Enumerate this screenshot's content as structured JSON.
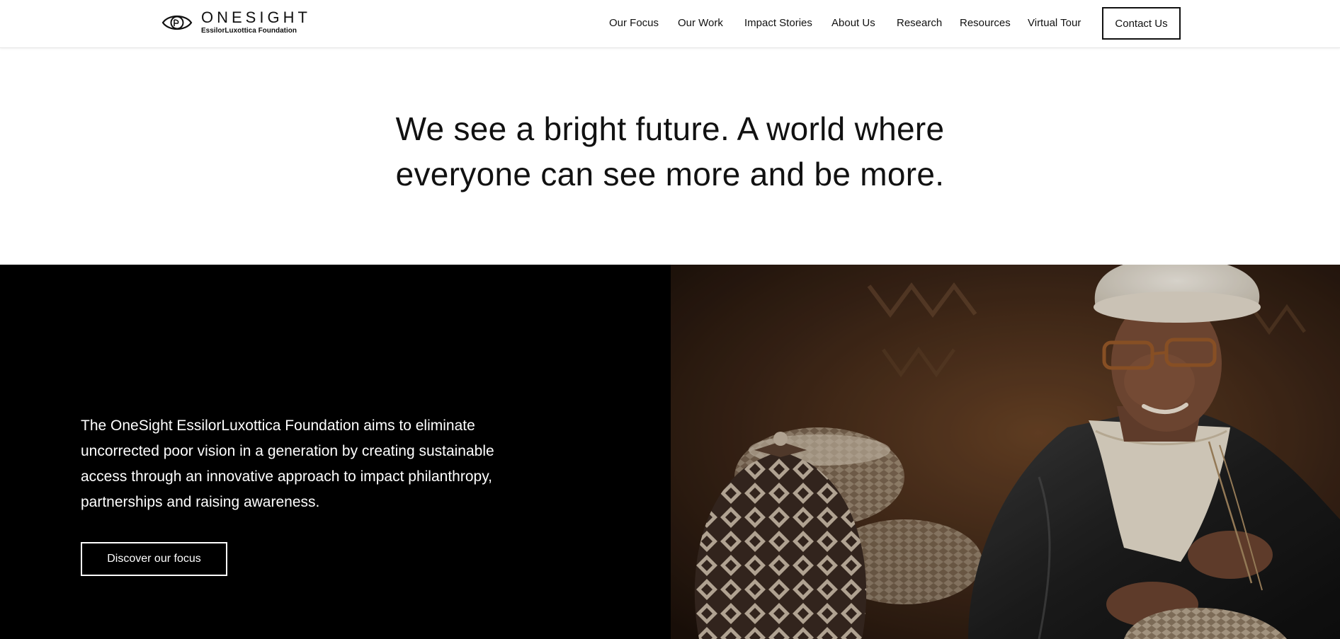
{
  "header": {
    "logo": {
      "title": "ONESIGHT",
      "subtitle": "EssilorLuxottica Foundation",
      "icon": "eye-logo-icon"
    },
    "nav": [
      {
        "label": "Our Focus"
      },
      {
        "label": "Our Work"
      },
      {
        "label": "Impact Stories"
      },
      {
        "label": "About Us"
      },
      {
        "label": "Research"
      },
      {
        "label": "Resources"
      },
      {
        "label": "Virtual Tour"
      }
    ],
    "contact_label": "Contact Us"
  },
  "hero": {
    "headline_line1": "We see a bright future. A world where",
    "headline_line2": "everyone can see more and be more."
  },
  "mission": {
    "text": "The OneSight EssilorLuxottica Foundation aims to eliminate uncorrected poor vision in a generation by creating sustainable access through an innovative approach to impact philanthropy, partnerships and raising awareness.",
    "button_label": "Discover our focus"
  },
  "colors": {
    "text": "#111111",
    "dark_panel": "#000000",
    "background": "#ffffff"
  }
}
